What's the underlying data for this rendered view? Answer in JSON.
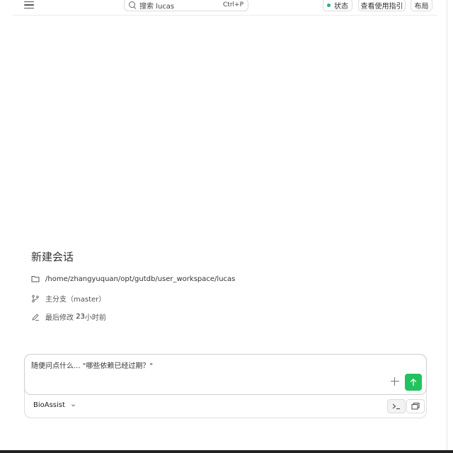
{
  "topbar": {
    "search_placeholder": "搜索 lucas",
    "search_shortcut": "Ctrl+P",
    "status_label": "状态",
    "status_color": "#22b573",
    "guide_label": "查看使用指引",
    "layout_label": "布局",
    "menu_icon": "hamburger-menu-icon",
    "search_icon": "magnifier-icon"
  },
  "session": {
    "title": "新建会话",
    "path_prefix": "/home/zhangyuquan/opt/gutdb/user_workspace/",
    "path_last": "lucas",
    "branch_label": "主分支",
    "branch_name": "（master）",
    "modified_label": "最后修改",
    "modified_value": "23",
    "modified_unit": "小时前",
    "folder_icon": "folder-icon",
    "branch_icon": "git-branch-icon",
    "edit_icon": "pencil-icon"
  },
  "composer": {
    "placeholder": "随便问点什么... \"哪些依赖已经过期？\"",
    "agent_name": "BioAssist",
    "send_color": "#22c35e",
    "plus_icon": "plus-icon",
    "send_icon": "arrow-up-icon",
    "chevron_icon": "chevron-down-icon",
    "terminal_icon": "terminal-icon",
    "window_icon": "copy-window-icon"
  }
}
